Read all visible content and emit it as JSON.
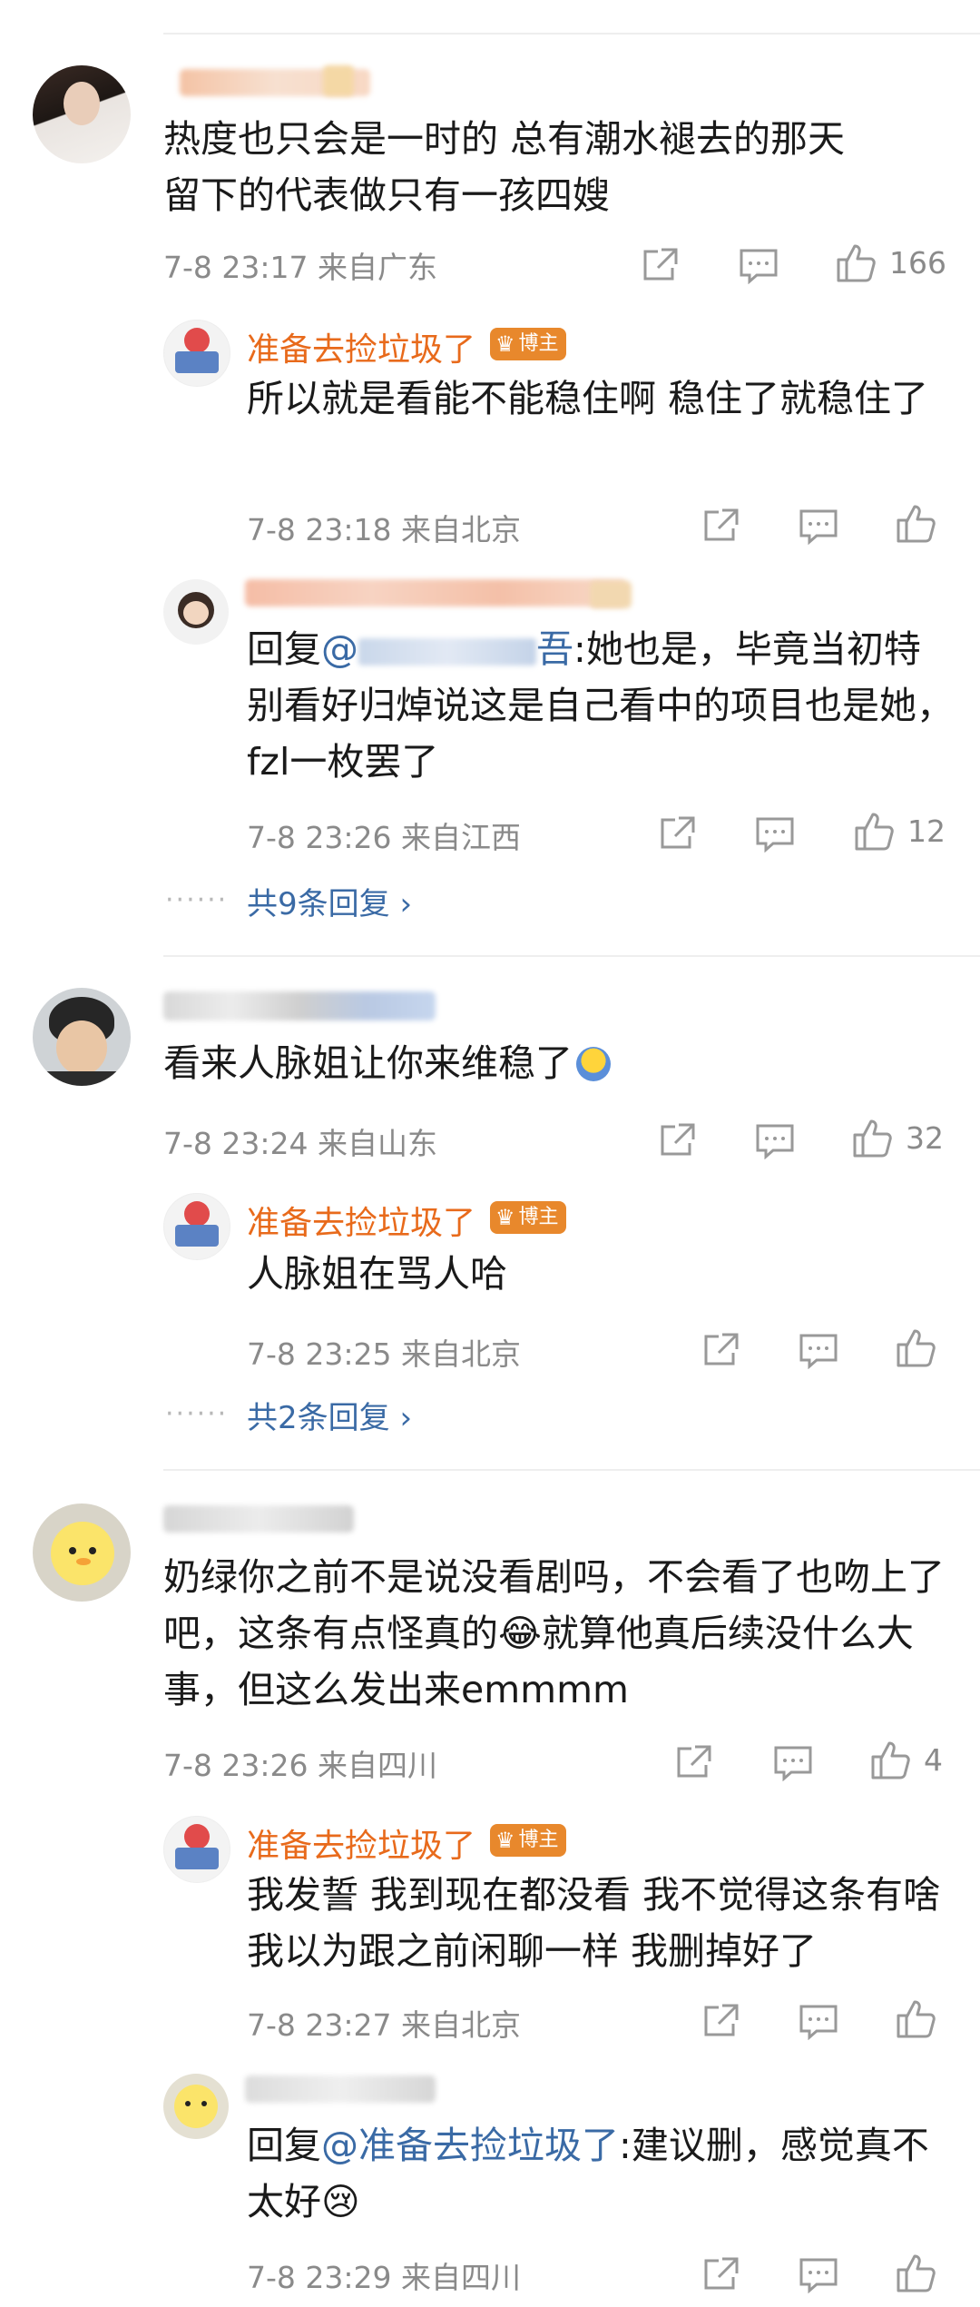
{
  "comments": [
    {
      "text": "热度也只会是一时的   总有潮水褪去的那天\n留下的代表做只有一孩四嫂",
      "meta": "7-8 23:17  来自广东",
      "likes": "166",
      "replies": [
        {
          "author": "准备去捡垃圾了",
          "badge": "博主",
          "text": "所以就是看能不能稳住啊 稳住了就稳住了",
          "meta": "7-8 23:18  来自北京",
          "likes": ""
        },
        {
          "author": "",
          "reply_prefix": "回复",
          "mention": "@",
          "mention_tail": "吾",
          "text": ":她也是，毕竟当初特别看好归焯说这是自己看中的项目也是她，fzl一枚罢了",
          "meta": "7-8 23:26  来自江西",
          "likes": "12"
        }
      ],
      "more_replies": "共9条回复 ›"
    },
    {
      "text": "看来人脉姐让你来维稳了",
      "meta": "7-8 23:24  来自山东",
      "likes": "32",
      "replies": [
        {
          "author": "准备去捡垃圾了",
          "badge": "博主",
          "text": "人脉姐在骂人哈",
          "meta": "7-8 23:25  来自北京",
          "likes": ""
        }
      ],
      "more_replies": "共2条回复 ›"
    },
    {
      "text": "奶绿你之前不是说没看剧吗，不会看了也吻上了吧，这条有点怪真的😂就算他真后续没什么大事，但这么发出来emmmm",
      "meta": "7-8 23:26  来自四川",
      "likes": "4",
      "replies": [
        {
          "author": "准备去捡垃圾了",
          "badge": "博主",
          "text": "我发誓 我到现在都没看 我不觉得这条有啥 我以为跟之前闲聊一样 我删掉好了",
          "meta": "7-8 23:27  来自北京",
          "likes": ""
        },
        {
          "author": "",
          "reply_prefix": "回复",
          "mention": "@准备去捡垃圾了",
          "text": ":建议删，感觉真不太好😢",
          "meta": "7-8 23:29  来自四川",
          "likes": ""
        }
      ]
    }
  ],
  "icons": [
    "share-icon",
    "comment-icon",
    "like-icon"
  ],
  "colors": {
    "author": "#e86a1b",
    "mention": "#3a6aa5",
    "meta": "#8a8a8a",
    "badge": "#e8882c"
  }
}
